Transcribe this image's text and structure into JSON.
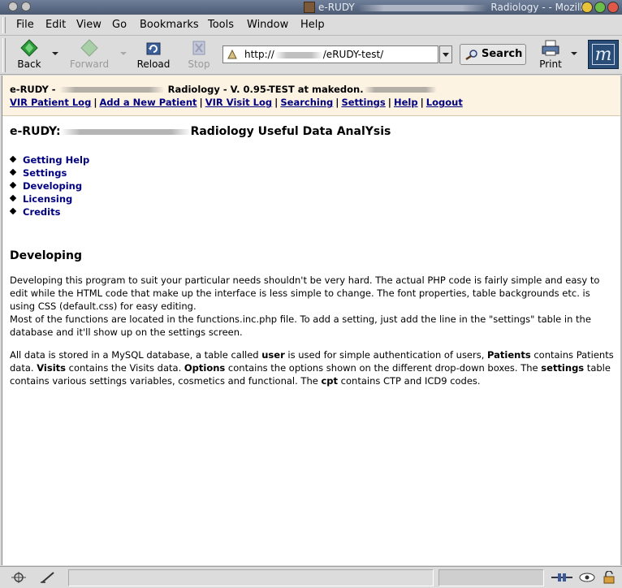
{
  "window": {
    "title_prefix": "e-RUDY",
    "title_suffix": "Radiology - - Mozilla"
  },
  "menu": [
    "File",
    "Edit",
    "View",
    "Go",
    "Bookmarks",
    "Tools",
    "Window",
    "Help"
  ],
  "toolbar": {
    "back": "Back",
    "forward": "Forward",
    "reload": "Reload",
    "stop": "Stop",
    "url_prefix": "http://",
    "url_suffix": "/eRUDY-test/",
    "search": "Search",
    "print": "Print"
  },
  "header": {
    "line1_prefix": "e-RUDY -",
    "line1_mid": "Radiology - V. 0.95-TEST at makedon.",
    "nav": [
      "VIR Patient Log",
      "Add a New Patient",
      "VIR Visit Log",
      "Searching",
      "Settings",
      "Help",
      "Logout"
    ]
  },
  "page": {
    "title_prefix": "e-RUDY:",
    "title_suffix": "Radiology Useful Data AnalYsis",
    "toc": [
      "Getting Help",
      "Settings",
      "Developing",
      "Licensing",
      "Credits"
    ],
    "section_title": "Developing",
    "para1": "Developing this program to suit your particular needs shouldn't be very hard. The actual PHP code is fairly simple and easy to edit while the HTML code that make up the interface is less simple to change. The font properties, table backgrounds etc. is using CSS (default.css) for easy editing.",
    "para2": "Most of the functions are located in the functions.inc.php file. To add a setting, just add the line in the \"settings\" table in the database and it'll show up on the settings screen.",
    "para3": {
      "t1": "All data is stored in a MySQL database, a table called ",
      "b1": "user",
      "t2": " is used for simple authentication of users, ",
      "b2": "Patients",
      "t3": " contains Patients data. ",
      "b3": "Visits",
      "t4": " contains the Visits data. ",
      "b4": "Options",
      "t5": " contains the options shown on the different drop-down boxes. The ",
      "b5": "settings",
      "t6": " table contains various settings variables, cosmetics and functional. The ",
      "b6": "cpt",
      "t7": " contains CTP and ICD9 codes."
    }
  }
}
